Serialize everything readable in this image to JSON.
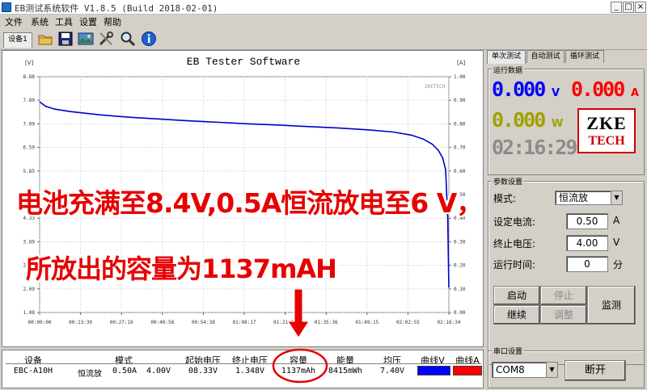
{
  "window": {
    "title": "EB测试系统软件 V1.8.5 (Build 2018-02-01)",
    "min": "_",
    "max": "□",
    "close": "×"
  },
  "menu": [
    "文件",
    "系统",
    "工具",
    "设置",
    "帮助"
  ],
  "toolbar": {
    "device_tab": "设备1",
    "tools": [
      "folder-icon",
      "save-icon",
      "image-icon",
      "tools-icon",
      "search-icon",
      "info-icon"
    ]
  },
  "overlays": {
    "line1": "电池充满至8.4V,0.5A恒流放电至6 V，",
    "line2": "所放出的容量为1137mAH"
  },
  "chart_data": {
    "type": "line",
    "title": "EB Tester Software",
    "watermark": "ZKETECH",
    "y_left_unit": "[V]",
    "y_right_unit": "[A]",
    "ylim_left": [
      1.08,
      8.88
    ],
    "ylim_right": [
      0.0,
      1.0
    ],
    "y_left_ticks": [
      "8.88",
      "7.80",
      "7.09",
      "6.59",
      "5.85",
      "4.99",
      "4.33",
      "3.89",
      "2.79",
      "2.09",
      "1.08"
    ],
    "y_right_ticks": [
      "1.00",
      "0.90",
      "0.80",
      "0.70",
      "0.60",
      "0.50",
      "0.40",
      "0.30",
      "0.20",
      "0.10",
      "0.00"
    ],
    "x_ticks": [
      "00:00:00",
      "00:13:39",
      "00:27:19",
      "00:40:58",
      "00:54:38",
      "01:08:17",
      "01:21:57",
      "01:35:36",
      "01:49:15",
      "02:02:55",
      "02:16:34"
    ],
    "series": [
      {
        "name": "曲线V",
        "color": "#0000cc",
        "x": [
          0,
          2,
          5,
          10,
          20,
          30,
          40,
          50,
          60,
          70,
          80,
          90,
          100,
          110,
          118,
          124,
          128,
          131,
          133,
          134.5,
          135.5,
          136.2,
          136.57
        ],
        "y": [
          8.05,
          7.9,
          7.81,
          7.73,
          7.62,
          7.54,
          7.48,
          7.42,
          7.37,
          7.32,
          7.28,
          7.23,
          7.18,
          7.12,
          7.05,
          6.95,
          6.82,
          6.65,
          6.45,
          6.2,
          5.8,
          4.2,
          1.9
        ]
      },
      {
        "name": "曲线A",
        "color": "#ff0000",
        "values": []
      }
    ]
  },
  "table": {
    "headers": [
      "设备",
      "模式",
      "起始电压",
      "终止电压",
      "容量",
      "能量",
      "均压",
      "曲线V",
      "曲线A"
    ],
    "row": {
      "device": "EBC-A10H",
      "mode": "恒流放",
      "mode_current": "0.50A",
      "mode_voltage": "4.00V",
      "start_voltage": "08.33V",
      "end_voltage": "1.348V",
      "capacity": "1137mAh",
      "energy": "8415mWh",
      "avg_voltage": "7.40V"
    },
    "swatch_v": "#0000ff",
    "swatch_a": "#ff0000"
  },
  "right": {
    "tabs": [
      "单次测试",
      "自动测试",
      "循环测试"
    ],
    "run_group": "运行数据",
    "voltage": "0.000",
    "voltage_unit": "V",
    "current": "0.000",
    "current_unit": "A",
    "power": "0.000",
    "power_unit": "W",
    "timer": "02:16:29",
    "logo_top": "ZKE",
    "logo_bottom": "TECH",
    "param_group": "参数设置",
    "mode_label": "模式:",
    "mode_value": "恒流放",
    "current_label": "设定电流:",
    "current_value": "0.50",
    "current_unit_label": "A",
    "cutoff_label": "终止电压:",
    "cutoff_value": "4.00",
    "cutoff_unit_label": "V",
    "runtime_label": "运行时间:",
    "runtime_value": "0",
    "runtime_unit_label": "分",
    "btn_start": "启动",
    "btn_stop": "停止",
    "btn_continue": "继续",
    "btn_adjust": "调整",
    "btn_monitor": "监测",
    "serial_group": "串口设置",
    "com_port": "COM8",
    "btn_disconnect": "断开"
  },
  "colors": {
    "blue_digits": "#0000ff",
    "red_digits": "#ff0000",
    "olive_digits": "#a0a000",
    "timer_gray": "#8c8c8c",
    "logo_red": "#cc0000"
  }
}
